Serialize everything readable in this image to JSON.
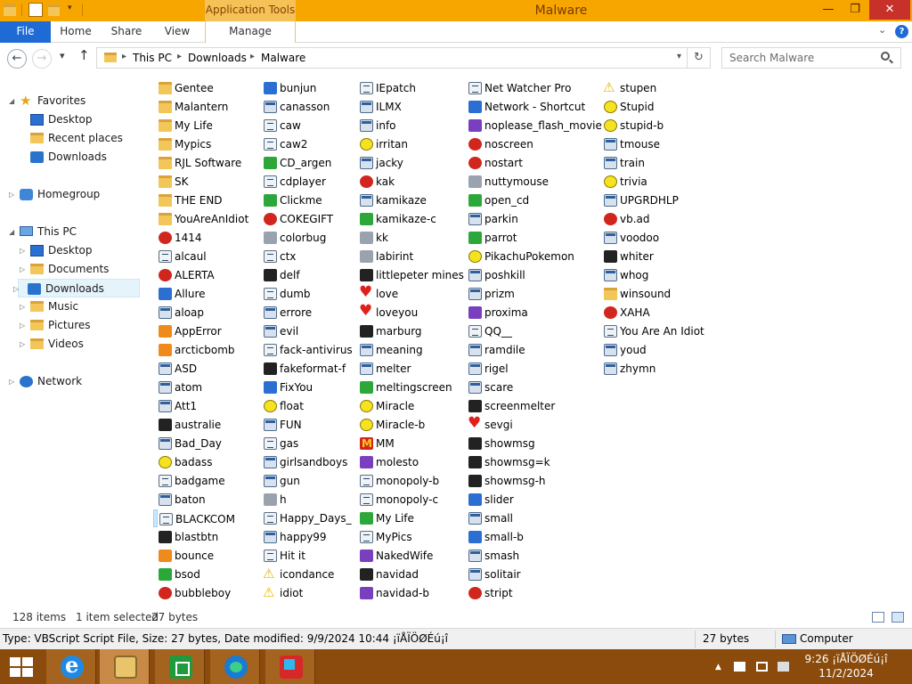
{
  "window": {
    "title": "Malware",
    "context_tab": "Application Tools",
    "minimize": "—",
    "maximize": "❐",
    "close": "✕"
  },
  "ribbon": {
    "tabs": [
      "File",
      "Home",
      "Share",
      "View",
      "Manage"
    ],
    "expand": "⌄",
    "help": "?"
  },
  "address": {
    "back": "←",
    "forward": "→",
    "recent": "▾",
    "up": "↑",
    "crumbs": [
      "This PC",
      "Downloads",
      "Malware"
    ],
    "separator": "▸",
    "dropdown": "▾",
    "refresh": "↻",
    "search_placeholder": "Search Malware"
  },
  "nav": {
    "items": [
      {
        "label": "Favorites",
        "icon": "star-icon",
        "level": 0,
        "arrow": "◢"
      },
      {
        "label": "Desktop",
        "icon": "desktop-icon",
        "level": 1
      },
      {
        "label": "Recent places",
        "icon": "recent-places-icon",
        "level": 1
      },
      {
        "label": "Downloads",
        "icon": "downloads-icon",
        "level": 1
      },
      {
        "label": "Homegroup",
        "icon": "homegroup-icon",
        "level": 0,
        "arrow": "▷"
      },
      {
        "label": "This PC",
        "icon": "computer-icon",
        "level": 0,
        "arrow": "◢"
      },
      {
        "label": "Desktop",
        "icon": "desktop-icon",
        "level": 1,
        "arrow": "▷"
      },
      {
        "label": "Documents",
        "icon": "documents-icon",
        "level": 1,
        "arrow": "▷"
      },
      {
        "label": "Downloads",
        "icon": "downloads-icon",
        "level": 1,
        "arrow": "▷",
        "selected": true
      },
      {
        "label": "Music",
        "icon": "music-icon",
        "level": 1,
        "arrow": "▷"
      },
      {
        "label": "Pictures",
        "icon": "pictures-icon",
        "level": 1,
        "arrow": "▷"
      },
      {
        "label": "Videos",
        "icon": "videos-icon",
        "level": 1,
        "arrow": "▷"
      },
      {
        "label": "Network",
        "icon": "network-icon",
        "level": 0,
        "arrow": "▷"
      }
    ]
  },
  "files": [
    [
      "Gentee",
      "folder"
    ],
    [
      "Malantern",
      "folder"
    ],
    [
      "My Life",
      "folder"
    ],
    [
      "Mypics",
      "folder"
    ],
    [
      "RJL Software",
      "folder"
    ],
    [
      "SK",
      "folder"
    ],
    [
      "THE END",
      "folder"
    ],
    [
      "YouAreAnIdiot",
      "folder"
    ],
    [
      "1414",
      "red"
    ],
    [
      "alcaul",
      "script"
    ],
    [
      "ALERTA",
      "red"
    ],
    [
      "Allure",
      "blue"
    ],
    [
      "aloap",
      "win"
    ],
    [
      "AppError",
      "orange"
    ],
    [
      "arcticbomb",
      "orange"
    ],
    [
      "ASD",
      "win"
    ],
    [
      "atom",
      "win"
    ],
    [
      "Att1",
      "win"
    ],
    [
      "australie",
      "dark"
    ],
    [
      "Bad_Day",
      "win"
    ],
    [
      "badass",
      "smiley"
    ],
    [
      "badgame",
      "script"
    ],
    [
      "baton",
      "win"
    ],
    [
      "BLACKCOM",
      "script"
    ],
    [
      "blastbtn",
      "dark"
    ],
    [
      "bounce",
      "orange"
    ],
    [
      "bsod",
      "green"
    ],
    [
      "bubbleboy",
      "red"
    ],
    [
      "bunjun",
      "blue"
    ],
    [
      "canasson",
      "win"
    ],
    [
      "caw",
      "script"
    ],
    [
      "caw2",
      "script"
    ],
    [
      "CD_argen",
      "green"
    ],
    [
      "cdplayer",
      "script"
    ],
    [
      "Clickme",
      "green"
    ],
    [
      "COKEGIFT",
      "red"
    ],
    [
      "colorbug",
      "gray"
    ],
    [
      "ctx",
      "script"
    ],
    [
      "delf",
      "dark"
    ],
    [
      "dumb",
      "script"
    ],
    [
      "errore",
      "win"
    ],
    [
      "evil",
      "win"
    ],
    [
      "fack-antivirus",
      "script"
    ],
    [
      "fakeformat-f",
      "dark"
    ],
    [
      "FixYou",
      "blue"
    ],
    [
      "float",
      "smiley"
    ],
    [
      "FUN",
      "win"
    ],
    [
      "gas",
      "script"
    ],
    [
      "girlsandboys",
      "win"
    ],
    [
      "gun",
      "win"
    ],
    [
      "h",
      "gray"
    ],
    [
      "Happy_Days_",
      "script"
    ],
    [
      "happy99",
      "win"
    ],
    [
      "Hit it",
      "script"
    ],
    [
      "icondance",
      "warn"
    ],
    [
      "idiot",
      "warn"
    ],
    [
      "IEpatch",
      "script"
    ],
    [
      "ILMX",
      "win"
    ],
    [
      "info",
      "win"
    ],
    [
      "irritan",
      "smiley"
    ],
    [
      "jacky",
      "win"
    ],
    [
      "kak",
      "red"
    ],
    [
      "kamikaze",
      "win"
    ],
    [
      "kamikaze-c",
      "green"
    ],
    [
      "kk",
      "gray"
    ],
    [
      "labirint",
      "gray"
    ],
    [
      "littlepeter mines",
      "dark"
    ],
    [
      "love",
      "heart"
    ],
    [
      "loveyou",
      "heart"
    ],
    [
      "marburg",
      "dark"
    ],
    [
      "meaning",
      "win"
    ],
    [
      "melter",
      "win"
    ],
    [
      "meltingscreen",
      "green"
    ],
    [
      "Miracle",
      "smiley"
    ],
    [
      "Miracle-b",
      "smiley"
    ],
    [
      "MM",
      "mc"
    ],
    [
      "molesto",
      "purple"
    ],
    [
      "monopoly-b",
      "script"
    ],
    [
      "monopoly-c",
      "script"
    ],
    [
      "My Life",
      "green"
    ],
    [
      "MyPics",
      "script"
    ],
    [
      "NakedWife",
      "purple"
    ],
    [
      "navidad",
      "dark"
    ],
    [
      "navidad-b",
      "purple"
    ],
    [
      "Net Watcher Pro",
      "script"
    ],
    [
      "Network - Shortcut",
      "blue"
    ],
    [
      "noplease_flash_movie",
      "purple"
    ],
    [
      "noscreen",
      "red"
    ],
    [
      "nostart",
      "red"
    ],
    [
      "nuttymouse",
      "gray"
    ],
    [
      "open_cd",
      "green"
    ],
    [
      "parkin",
      "win"
    ],
    [
      "parrot",
      "green"
    ],
    [
      "PikachuPokemon",
      "smiley"
    ],
    [
      "poshkill",
      "win"
    ],
    [
      "prizm",
      "win"
    ],
    [
      "proxima",
      "purple"
    ],
    [
      "QQ__",
      "script"
    ],
    [
      "ramdile",
      "win"
    ],
    [
      "rigel",
      "win"
    ],
    [
      "scare",
      "win"
    ],
    [
      "screenmelter",
      "dark"
    ],
    [
      "sevgi",
      "heart"
    ],
    [
      "showmsg",
      "dark"
    ],
    [
      "showmsg=k",
      "dark"
    ],
    [
      "showmsg-h",
      "dark"
    ],
    [
      "slider",
      "blue"
    ],
    [
      "small",
      "win"
    ],
    [
      "small-b",
      "blue"
    ],
    [
      "smash",
      "win"
    ],
    [
      "solitair",
      "win"
    ],
    [
      "stript",
      "red"
    ],
    [
      "stupen",
      "warn"
    ],
    [
      "Stupid",
      "smiley"
    ],
    [
      "stupid-b",
      "smiley"
    ],
    [
      "tmouse",
      "win"
    ],
    [
      "train",
      "win"
    ],
    [
      "trivia",
      "smiley"
    ],
    [
      "UPGRDHLP",
      "win"
    ],
    [
      "vb.ad",
      "red"
    ],
    [
      "voodoo",
      "win"
    ],
    [
      "whiter",
      "dark"
    ],
    [
      "whog",
      "win"
    ],
    [
      "winsound",
      "folder"
    ],
    [
      "XAHA",
      "red"
    ],
    [
      "You Are An Idiot",
      "script"
    ],
    [
      "youd",
      "win"
    ],
    [
      "zhymn",
      "win"
    ]
  ],
  "selected_file": "BLACKCOM",
  "status": {
    "count": "128 items",
    "selection": "1 item selected",
    "size": "27 bytes"
  },
  "details": {
    "info": "Type: VBScript Script File, Size: 27 bytes, Date modified: 9/9/2024 10:44 ¡ïÅÏÖØÉú¡î",
    "size": "27 bytes",
    "location": "Computer"
  },
  "taskbar": {
    "apps": [
      "internet-explorer-icon",
      "file-explorer-icon",
      "store-icon",
      "edge-icon",
      "app-icon"
    ],
    "tray_arrow": "▲",
    "time": "9:26 ¡ïÅÏÖØÉú¡î",
    "date": "11/2/2024"
  },
  "colors": {
    "title_bar": "#f7a600",
    "taskbar": "#8a4b0c",
    "file_tab": "#1e6bd6",
    "selection": "#cce8ff"
  }
}
